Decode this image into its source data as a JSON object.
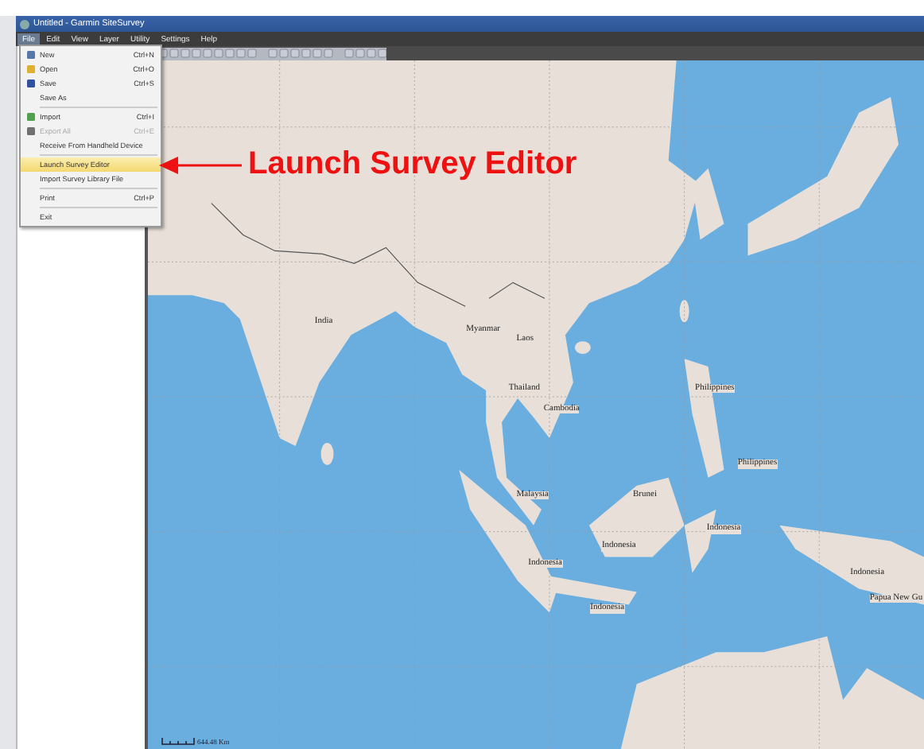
{
  "window": {
    "title": "Untitled - Garmin SiteSurvey"
  },
  "menu_bar": [
    {
      "label": "File",
      "selected": true
    },
    {
      "label": "Edit",
      "selected": false
    },
    {
      "label": "View",
      "selected": false
    },
    {
      "label": "Layer",
      "selected": false
    },
    {
      "label": "Utility",
      "selected": false
    },
    {
      "label": "Settings",
      "selected": false
    },
    {
      "label": "Help",
      "selected": false
    }
  ],
  "file_menu": [
    {
      "kind": "item",
      "label": "New",
      "shortcut": "Ctrl+N",
      "disabled": false,
      "selected": false
    },
    {
      "kind": "item",
      "label": "Open",
      "shortcut": "Ctrl+O",
      "disabled": false,
      "selected": false
    },
    {
      "kind": "item",
      "label": "Save",
      "shortcut": "Ctrl+S",
      "disabled": false,
      "selected": false
    },
    {
      "kind": "item",
      "label": "Save As",
      "disabled": false,
      "selected": false
    },
    {
      "kind": "separator"
    },
    {
      "kind": "item",
      "label": "Import",
      "shortcut": "Ctrl+I",
      "disabled": false,
      "selected": false
    },
    {
      "kind": "item",
      "label": "Export All",
      "shortcut": "Ctrl+E",
      "disabled": true,
      "selected": false
    },
    {
      "kind": "item",
      "label": "Receive From Handheld Device",
      "disabled": false,
      "selected": false
    },
    {
      "kind": "separator"
    },
    {
      "kind": "item",
      "label": "Launch Survey Editor",
      "disabled": false,
      "selected": true
    },
    {
      "kind": "item",
      "label": "Import Survey Library File",
      "disabled": false,
      "selected": false
    },
    {
      "kind": "separator"
    },
    {
      "kind": "item",
      "label": "Print",
      "shortcut": "Ctrl+P",
      "disabled": false,
      "selected": false
    },
    {
      "kind": "separator"
    },
    {
      "kind": "item",
      "label": "Exit",
      "disabled": false,
      "selected": false
    }
  ],
  "map": {
    "labels": [
      {
        "text": "India"
      },
      {
        "text": "Myanmar"
      },
      {
        "text": "Laos"
      },
      {
        "text": "Thailand"
      },
      {
        "text": "Cambodia"
      },
      {
        "text": "Philippines"
      },
      {
        "text": "Philippines"
      },
      {
        "text": "Malaysia"
      },
      {
        "text": "Brunei"
      },
      {
        "text": "Indonesia"
      },
      {
        "text": "Indonesia"
      },
      {
        "text": "Indonesia"
      },
      {
        "text": "Indonesia"
      },
      {
        "text": "Indonesia"
      },
      {
        "text": "Papua New Gu"
      }
    ],
    "scale": "644.48 Km"
  },
  "annotation": {
    "text": "Launch Survey Editor"
  }
}
